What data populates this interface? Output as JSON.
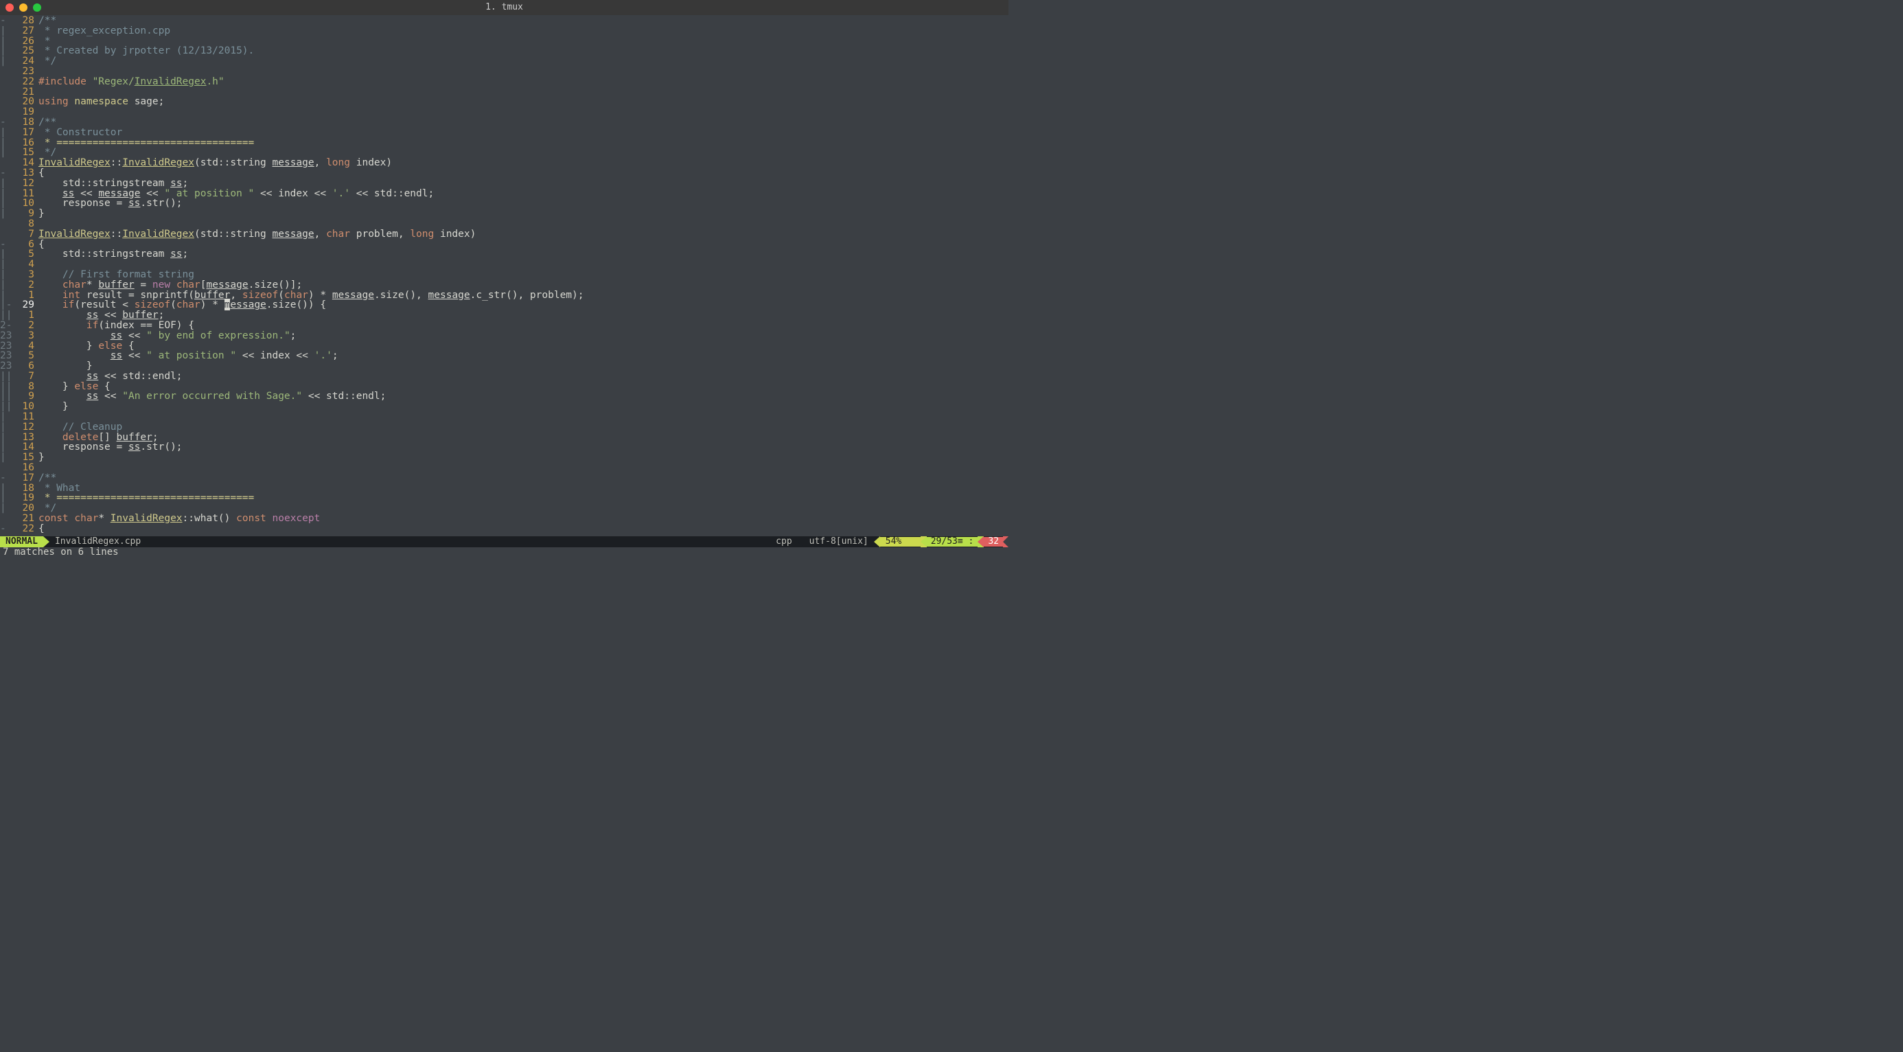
{
  "title": "1. tmux",
  "lines": [
    {
      "g": "-",
      "n": "28",
      "t": [
        [
          "cm",
          "/**"
        ]
      ]
    },
    {
      "g": "|",
      "n": "27",
      "t": [
        [
          "cm",
          " * regex_exception.cpp"
        ]
      ]
    },
    {
      "g": "|",
      "n": "26",
      "t": [
        [
          "cm",
          " *"
        ]
      ]
    },
    {
      "g": "|",
      "n": "25",
      "t": [
        [
          "cm",
          " * Created by jrpotter (12/13/2015)."
        ]
      ]
    },
    {
      "g": "|",
      "n": "24",
      "t": [
        [
          "cm",
          " */"
        ]
      ]
    },
    {
      "g": "",
      "n": "23",
      "t": []
    },
    {
      "g": "",
      "n": "22",
      "t": [
        [
          "rd",
          "#include "
        ],
        [
          "gr",
          "\"Regex/"
        ],
        [
          "gr ul",
          "InvalidRegex"
        ],
        [
          "gr",
          ".h\""
        ]
      ]
    },
    {
      "g": "",
      "n": "21",
      "t": []
    },
    {
      "g": "",
      "n": "20",
      "t": [
        [
          "rd",
          "using "
        ],
        [
          "yl",
          "namespace"
        ],
        [
          "wh",
          " sage;"
        ]
      ]
    },
    {
      "g": "",
      "n": "19",
      "t": []
    },
    {
      "g": "-",
      "n": "18",
      "t": [
        [
          "cm",
          "/**"
        ]
      ]
    },
    {
      "g": "|",
      "n": "17",
      "t": [
        [
          "cm",
          " * Constructor"
        ]
      ]
    },
    {
      "g": "|",
      "n": "16",
      "t": [
        [
          "yl",
          " * ================================="
        ]
      ]
    },
    {
      "g": "|",
      "n": "15",
      "t": [
        [
          "cm",
          " */"
        ]
      ]
    },
    {
      "g": "",
      "n": "14",
      "t": [
        [
          "yl ul",
          "InvalidRegex"
        ],
        [
          "wh",
          "::"
        ],
        [
          "yl ul",
          "InvalidRegex"
        ],
        [
          "wh",
          "(std::string "
        ],
        [
          "wh ul",
          "message"
        ],
        [
          "wh",
          ", "
        ],
        [
          "rd",
          "long"
        ],
        [
          "wh",
          " index)"
        ]
      ]
    },
    {
      "g": "-",
      "n": "13",
      "t": [
        [
          "wh",
          "{"
        ]
      ]
    },
    {
      "g": "|",
      "n": "12",
      "t": [
        [
          "wh",
          "    std::stringstream "
        ],
        [
          "wh ul",
          "ss"
        ],
        [
          "wh",
          ";"
        ]
      ]
    },
    {
      "g": "|",
      "n": "11",
      "t": [
        [
          "wh",
          "    "
        ],
        [
          "wh ul",
          "ss"
        ],
        [
          "wh",
          " << "
        ],
        [
          "wh ul",
          "message"
        ],
        [
          "wh",
          " << "
        ],
        [
          "gr",
          "\" at position \""
        ],
        [
          "wh",
          " << index << "
        ],
        [
          "gr",
          "'.'"
        ],
        [
          "wh",
          " << std::endl;"
        ]
      ]
    },
    {
      "g": "|",
      "n": "10",
      "t": [
        [
          "wh",
          "    response = "
        ],
        [
          "wh ul",
          "ss"
        ],
        [
          "wh",
          ".str();"
        ]
      ]
    },
    {
      "g": "|",
      "n": "9",
      "t": [
        [
          "wh",
          "}"
        ]
      ]
    },
    {
      "g": "",
      "n": "8",
      "t": []
    },
    {
      "g": "",
      "n": "7",
      "t": [
        [
          "yl ul",
          "InvalidRegex"
        ],
        [
          "wh",
          "::"
        ],
        [
          "yl ul",
          "InvalidRegex"
        ],
        [
          "wh",
          "(std::string "
        ],
        [
          "wh ul",
          "message"
        ],
        [
          "wh",
          ", "
        ],
        [
          "rd",
          "char"
        ],
        [
          "wh",
          " problem, "
        ],
        [
          "rd",
          "long"
        ],
        [
          "wh",
          " index)"
        ]
      ]
    },
    {
      "g": "-",
      "n": "6",
      "t": [
        [
          "wh",
          "{"
        ]
      ]
    },
    {
      "g": "|",
      "n": "5",
      "t": [
        [
          "wh",
          "    std::stringstream "
        ],
        [
          "wh ul",
          "ss"
        ],
        [
          "wh",
          ";"
        ]
      ]
    },
    {
      "g": "|",
      "n": "4",
      "t": []
    },
    {
      "g": "|",
      "n": "3",
      "t": [
        [
          "cm",
          "    // First format string"
        ]
      ]
    },
    {
      "g": "|",
      "n": "2",
      "t": [
        [
          "wh",
          "    "
        ],
        [
          "rd",
          "char"
        ],
        [
          "wh",
          "* "
        ],
        [
          "wh ul",
          "buffer"
        ],
        [
          "wh",
          " = "
        ],
        [
          "mg",
          "new"
        ],
        [
          "wh",
          " "
        ],
        [
          "rd",
          "char"
        ],
        [
          "wh",
          "["
        ],
        [
          "wh ul",
          "message"
        ],
        [
          "wh",
          ".size()];"
        ]
      ]
    },
    {
      "g": "|",
      "n": "1",
      "t": [
        [
          "wh",
          "    "
        ],
        [
          "rd",
          "int"
        ],
        [
          "wh",
          " result = snprintf("
        ],
        [
          "wh ul",
          "buffer"
        ],
        [
          "wh",
          ", "
        ],
        [
          "rd",
          "sizeof"
        ],
        [
          "wh",
          "("
        ],
        [
          "rd",
          "char"
        ],
        [
          "wh",
          ") * "
        ],
        [
          "wh ul",
          "message"
        ],
        [
          "wh",
          ".size(), "
        ],
        [
          "wh ul",
          "message"
        ],
        [
          "wh",
          ".c_str(), problem);"
        ]
      ]
    },
    {
      "g": "|-",
      "n": "29",
      "hl": true,
      "t": [
        [
          "wh",
          "    "
        ],
        [
          "rd",
          "if"
        ],
        [
          "wh",
          "(result < "
        ],
        [
          "rd",
          "sizeof"
        ],
        [
          "wh",
          "("
        ],
        [
          "rd",
          "char"
        ],
        [
          "wh",
          ") * "
        ],
        [
          "cursor",
          "m"
        ],
        [
          "wh ul",
          "essage"
        ],
        [
          "wh",
          ".size()) {"
        ]
      ]
    },
    {
      "g": "||",
      "n": "1",
      "t": [
        [
          "wh",
          "        "
        ],
        [
          "wh ul",
          "ss"
        ],
        [
          "wh",
          " << "
        ],
        [
          "wh ul",
          "buffer"
        ],
        [
          "wh",
          ";"
        ]
      ]
    },
    {
      "g": "2-",
      "n": "2",
      "t": [
        [
          "wh",
          "        "
        ],
        [
          "rd",
          "if"
        ],
        [
          "wh",
          "(index == EOF) {"
        ]
      ]
    },
    {
      "g": "23",
      "n": "3",
      "t": [
        [
          "wh",
          "            "
        ],
        [
          "wh ul",
          "ss"
        ],
        [
          "wh",
          " << "
        ],
        [
          "gr",
          "\" by end of expression.\""
        ],
        [
          "wh",
          ";"
        ]
      ]
    },
    {
      "g": "23",
      "n": "4",
      "t": [
        [
          "wh",
          "        } "
        ],
        [
          "rd",
          "else"
        ],
        [
          "wh",
          " {"
        ]
      ]
    },
    {
      "g": "23",
      "n": "5",
      "t": [
        [
          "wh",
          "            "
        ],
        [
          "wh ul",
          "ss"
        ],
        [
          "wh",
          " << "
        ],
        [
          "gr",
          "\" at position \""
        ],
        [
          "wh",
          " << index << "
        ],
        [
          "gr",
          "'.'"
        ],
        [
          "wh",
          ";"
        ]
      ]
    },
    {
      "g": "23",
      "n": "6",
      "t": [
        [
          "wh",
          "        }"
        ]
      ]
    },
    {
      "g": "||",
      "n": "7",
      "t": [
        [
          "wh",
          "        "
        ],
        [
          "wh ul",
          "ss"
        ],
        [
          "wh",
          " << std::endl;"
        ]
      ]
    },
    {
      "g": "||",
      "n": "8",
      "t": [
        [
          "wh",
          "    } "
        ],
        [
          "rd",
          "else"
        ],
        [
          "wh",
          " {"
        ]
      ]
    },
    {
      "g": "||",
      "n": "9",
      "t": [
        [
          "wh",
          "        "
        ],
        [
          "wh ul",
          "ss"
        ],
        [
          "wh",
          " << "
        ],
        [
          "gr",
          "\"An error occurred with Sage.\""
        ],
        [
          "wh",
          " << std::endl;"
        ]
      ]
    },
    {
      "g": "||",
      "n": "10",
      "t": [
        [
          "wh",
          "    }"
        ]
      ]
    },
    {
      "g": "|",
      "n": "11",
      "t": []
    },
    {
      "g": "|",
      "n": "12",
      "t": [
        [
          "cm",
          "    // Cleanup"
        ]
      ]
    },
    {
      "g": "|",
      "n": "13",
      "t": [
        [
          "wh",
          "    "
        ],
        [
          "rd",
          "delete"
        ],
        [
          "wh",
          "[] "
        ],
        [
          "wh ul",
          "buffer"
        ],
        [
          "wh",
          ";"
        ]
      ]
    },
    {
      "g": "|",
      "n": "14",
      "t": [
        [
          "wh",
          "    response = "
        ],
        [
          "wh ul",
          "ss"
        ],
        [
          "wh",
          ".str();"
        ]
      ]
    },
    {
      "g": "|",
      "n": "15",
      "t": [
        [
          "wh",
          "}"
        ]
      ]
    },
    {
      "g": "",
      "n": "16",
      "t": []
    },
    {
      "g": "-",
      "n": "17",
      "t": [
        [
          "cm",
          "/**"
        ]
      ]
    },
    {
      "g": "|",
      "n": "18",
      "t": [
        [
          "cm",
          " * What"
        ]
      ]
    },
    {
      "g": "|",
      "n": "19",
      "t": [
        [
          "yl",
          " * ================================="
        ]
      ]
    },
    {
      "g": "|",
      "n": "20",
      "t": [
        [
          "cm",
          " */"
        ]
      ]
    },
    {
      "g": "",
      "n": "21",
      "t": [
        [
          "rd",
          "const char"
        ],
        [
          "wh",
          "* "
        ],
        [
          "yl ul",
          "InvalidRegex"
        ],
        [
          "wh",
          "::what() "
        ],
        [
          "rd",
          "const "
        ],
        [
          "mg",
          "noexcept"
        ]
      ]
    },
    {
      "g": "-",
      "n": "22",
      "t": [
        [
          "wh",
          "{"
        ]
      ]
    }
  ],
  "status": {
    "mode": "NORMAL",
    "filename": "InvalidRegex.cpp",
    "filetype": "cpp",
    "encoding": "utf-8[unix]",
    "percent": "54%",
    "line": "29",
    "total": "53",
    "col": "32"
  },
  "footer": "7 matches on 6 lines"
}
